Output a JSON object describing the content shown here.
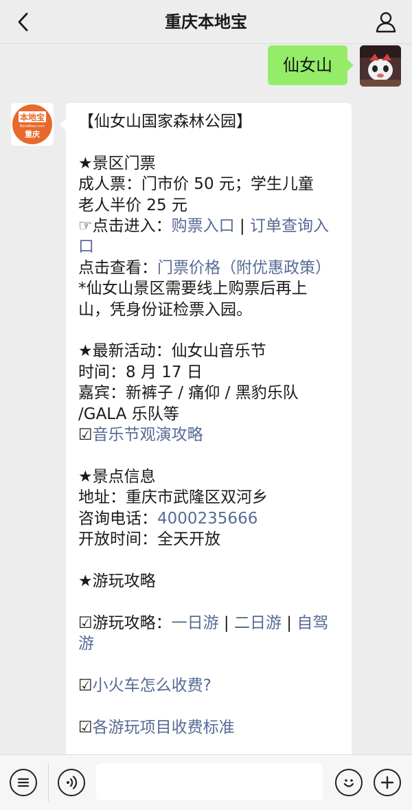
{
  "nav": {
    "title": "重庆本地宝",
    "back_icon": "chevron-left-icon",
    "user_icon": "person-icon"
  },
  "outgoing_message": {
    "text": "仙女山"
  },
  "bot_avatar": {
    "logo_top": "本地宝",
    "logo_small": "Bendibao.com",
    "logo_bottom": "重庆",
    "accent_color": "#e8692c"
  },
  "incoming_message": {
    "title": "【仙女山国家森林公园】",
    "tickets_heading": "★景区门票",
    "tickets_price_1": "成人票：门市价 50 元；学生儿童",
    "tickets_price_2": "老人半价 25 元",
    "buy_prefix": "☞点击进入：",
    "buy_link": "购票入口",
    "buy_sep": " | ",
    "order_link_1": "订单查询入",
    "order_link_2": "口",
    "view_prefix": "点击查看：",
    "price_link": "门票价格（附优惠政策）",
    "notice_1": "*仙女山景区需要线上购票后再上",
    "notice_2": "山，凭身份证检票入园。",
    "event_heading": "★最新活动：仙女山音乐节",
    "event_time": "时间：8 月 17 日",
    "event_guests_1": "嘉宾：新裤子 / 痛仰 / 黑豹乐队",
    "event_guests_2": "/GALA 乐队等",
    "event_check": "☑",
    "event_link": "音乐节观演攻略",
    "info_heading": "★景点信息",
    "info_address": "地址：重庆市武隆区双河乡",
    "info_phone_prefix": "咨询电话：",
    "info_phone": "4000235666",
    "info_hours": "开放时间：全天开放",
    "guide_heading": "★游玩攻略",
    "guide_prefix": "☑游玩攻略：",
    "guide_link_1": "一日游",
    "guide_sep_1": " | ",
    "guide_link_2": "二日游",
    "guide_sep_2": " | ",
    "guide_link_3a": "自驾",
    "guide_link_3b": "游",
    "train_check": "☑",
    "train_link": "小火车怎么收费?",
    "fees_check": "☑",
    "fees_link": "各游玩项目收费标准"
  },
  "bottom_bar": {
    "menu_icon": "menu-list-icon",
    "voice_icon": "voice-icon",
    "emoji_icon": "emoji-icon",
    "plus_icon": "plus-icon"
  }
}
